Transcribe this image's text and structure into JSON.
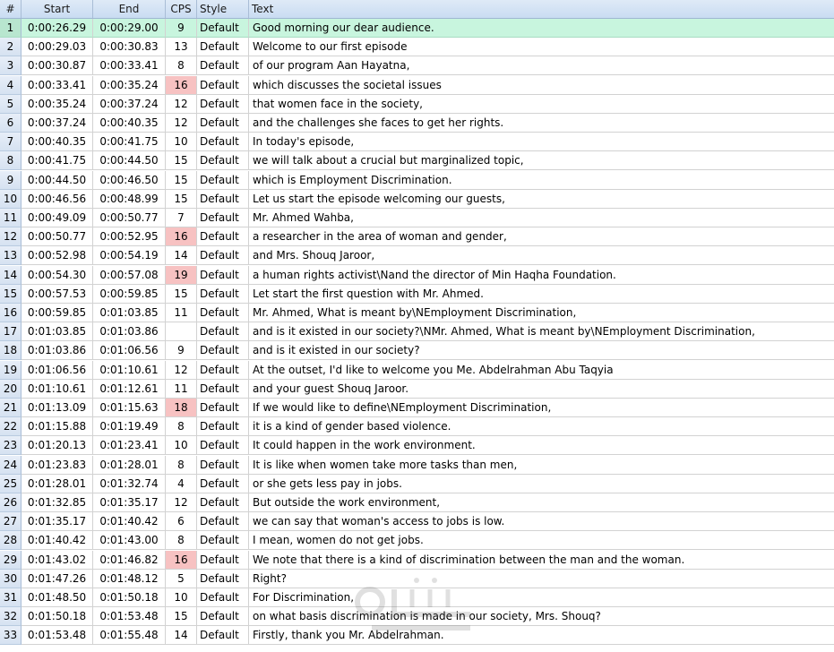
{
  "columns": {
    "num": "#",
    "start": "Start",
    "end": "End",
    "cps": "CPS",
    "style": "Style",
    "text": "Text"
  },
  "colors": {
    "header": "#c9dcf2",
    "selected_row": "#c8f5de",
    "cps_warning": "#f7c2c2",
    "grid_line": "#d2d2d2"
  },
  "rows": [
    {
      "num": "1",
      "start": "0:00:26.29",
      "end": "0:00:29.00",
      "cps": "9",
      "style": "Default",
      "text": "Good morning our dear audience.",
      "selected": true,
      "warn": false
    },
    {
      "num": "2",
      "start": "0:00:29.03",
      "end": "0:00:30.83",
      "cps": "13",
      "style": "Default",
      "text": "Welcome to our first episode",
      "warn": false
    },
    {
      "num": "3",
      "start": "0:00:30.87",
      "end": "0:00:33.41",
      "cps": "8",
      "style": "Default",
      "text": "of our program Aan Hayatna,",
      "warn": false
    },
    {
      "num": "4",
      "start": "0:00:33.41",
      "end": "0:00:35.24",
      "cps": "16",
      "style": "Default",
      "text": "which discusses the societal issues",
      "warn": true
    },
    {
      "num": "5",
      "start": "0:00:35.24",
      "end": "0:00:37.24",
      "cps": "12",
      "style": "Default",
      "text": "that women face in the society,",
      "warn": false
    },
    {
      "num": "6",
      "start": "0:00:37.24",
      "end": "0:00:40.35",
      "cps": "12",
      "style": "Default",
      "text": "and the challenges she faces to get her rights.",
      "warn": false
    },
    {
      "num": "7",
      "start": "0:00:40.35",
      "end": "0:00:41.75",
      "cps": "10",
      "style": "Default",
      "text": "In today's episode,",
      "warn": false
    },
    {
      "num": "8",
      "start": "0:00:41.75",
      "end": "0:00:44.50",
      "cps": "15",
      "style": "Default",
      "text": "we will talk about a crucial but marginalized topic,",
      "warn": false
    },
    {
      "num": "9",
      "start": "0:00:44.50",
      "end": "0:00:46.50",
      "cps": "15",
      "style": "Default",
      "text": "which is Employment Discrimination.",
      "warn": false
    },
    {
      "num": "10",
      "start": "0:00:46.56",
      "end": "0:00:48.99",
      "cps": "15",
      "style": "Default",
      "text": "Let us start the episode welcoming our guests,",
      "warn": false
    },
    {
      "num": "11",
      "start": "0:00:49.09",
      "end": "0:00:50.77",
      "cps": "7",
      "style": "Default",
      "text": "Mr. Ahmed Wahba,",
      "warn": false
    },
    {
      "num": "12",
      "start": "0:00:50.77",
      "end": "0:00:52.95",
      "cps": "16",
      "style": "Default",
      "text": "a researcher in the area of woman and gender,",
      "warn": true
    },
    {
      "num": "13",
      "start": "0:00:52.98",
      "end": "0:00:54.19",
      "cps": "14",
      "style": "Default",
      "text": "and Mrs. Shouq Jaroor,",
      "warn": false
    },
    {
      "num": "14",
      "start": "0:00:54.30",
      "end": "0:00:57.08",
      "cps": "19",
      "style": "Default",
      "text": "a human rights activist\\Nand the director of Min Haqha Foundation.",
      "warn": true
    },
    {
      "num": "15",
      "start": "0:00:57.53",
      "end": "0:00:59.85",
      "cps": "15",
      "style": "Default",
      "text": "Let start the first question with Mr. Ahmed.",
      "warn": false
    },
    {
      "num": "16",
      "start": "0:00:59.85",
      "end": "0:01:03.85",
      "cps": "11",
      "style": "Default",
      "text": "Mr. Ahmed, What is meant by\\NEmployment Discrimination,",
      "warn": false
    },
    {
      "num": "17",
      "start": "0:01:03.85",
      "end": "0:01:03.86",
      "cps": "",
      "style": "Default",
      "text": "and is it existed in our society?\\NMr. Ahmed, What is meant by\\NEmployment Discrimination,",
      "warn": false
    },
    {
      "num": "18",
      "start": "0:01:03.86",
      "end": "0:01:06.56",
      "cps": "9",
      "style": "Default",
      "text": "and is it existed in our society?",
      "warn": false
    },
    {
      "num": "19",
      "start": "0:01:06.56",
      "end": "0:01:10.61",
      "cps": "12",
      "style": "Default",
      "text": "At the outset, I'd like to welcome you Me. Abdelrahman Abu Taqyia",
      "warn": false
    },
    {
      "num": "20",
      "start": "0:01:10.61",
      "end": "0:01:12.61",
      "cps": "11",
      "style": "Default",
      "text": "and your guest Shouq Jaroor.",
      "warn": false
    },
    {
      "num": "21",
      "start": "0:01:13.09",
      "end": "0:01:15.63",
      "cps": "18",
      "style": "Default",
      "text": "If we would like to define\\NEmployment Discrimination,",
      "warn": true
    },
    {
      "num": "22",
      "start": "0:01:15.88",
      "end": "0:01:19.49",
      "cps": "8",
      "style": "Default",
      "text": "it is a kind of gender based violence.",
      "warn": false
    },
    {
      "num": "23",
      "start": "0:01:20.13",
      "end": "0:01:23.41",
      "cps": "10",
      "style": "Default",
      "text": "It could happen in the work environment.",
      "warn": false
    },
    {
      "num": "24",
      "start": "0:01:23.83",
      "end": "0:01:28.01",
      "cps": "8",
      "style": "Default",
      "text": "It is like when women take more tasks than men,",
      "warn": false
    },
    {
      "num": "25",
      "start": "0:01:28.01",
      "end": "0:01:32.74",
      "cps": "4",
      "style": "Default",
      "text": "or she gets less pay in jobs.",
      "warn": false
    },
    {
      "num": "26",
      "start": "0:01:32.85",
      "end": "0:01:35.17",
      "cps": "12",
      "style": "Default",
      "text": "But outside the work environment,",
      "warn": false
    },
    {
      "num": "27",
      "start": "0:01:35.17",
      "end": "0:01:40.42",
      "cps": "6",
      "style": "Default",
      "text": "we can say that woman's access to jobs is low.",
      "warn": false
    },
    {
      "num": "28",
      "start": "0:01:40.42",
      "end": "0:01:43.00",
      "cps": "8",
      "style": "Default",
      "text": "I mean, women do not get jobs.",
      "warn": false
    },
    {
      "num": "29",
      "start": "0:01:43.02",
      "end": "0:01:46.82",
      "cps": "16",
      "style": "Default",
      "text": "We note that there is a kind of discrimination between the man and the woman.",
      "warn": true
    },
    {
      "num": "30",
      "start": "0:01:47.26",
      "end": "0:01:48.12",
      "cps": "5",
      "style": "Default",
      "text": "Right?",
      "warn": false
    },
    {
      "num": "31",
      "start": "0:01:48.50",
      "end": "0:01:50.18",
      "cps": "10",
      "style": "Default",
      "text": "For Discrimination,",
      "warn": false
    },
    {
      "num": "32",
      "start": "0:01:50.18",
      "end": "0:01:53.48",
      "cps": "15",
      "style": "Default",
      "text": "on what basis discrimination is made in our society, Mrs. Shouq?",
      "warn": false
    },
    {
      "num": "33",
      "start": "0:01:53.48",
      "end": "0:01:55.48",
      "cps": "14",
      "style": "Default",
      "text": "Firstly, thank you Mr. Abdelrahman.",
      "warn": false
    }
  ]
}
